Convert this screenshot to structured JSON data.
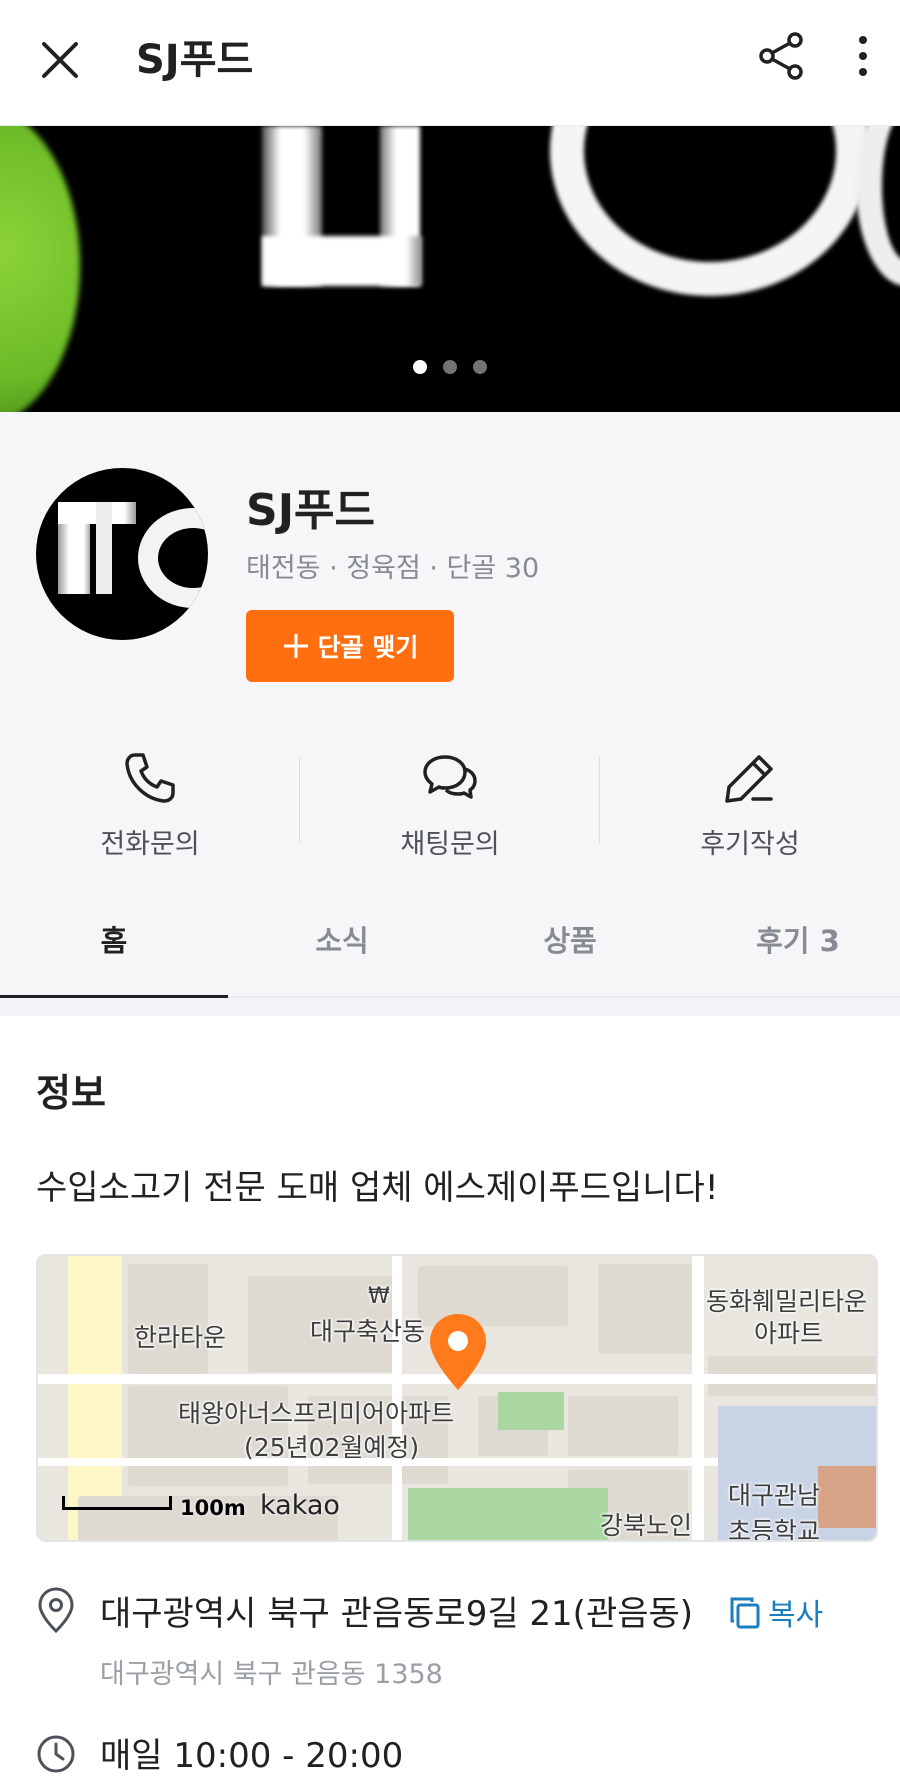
{
  "header": {
    "title": "SJ푸드",
    "icons": [
      "close-icon",
      "share-icon",
      "more-vertical-icon"
    ]
  },
  "banner": {
    "page_count": 3,
    "active_index": 0
  },
  "profile": {
    "name": "SJ푸드",
    "meta": "태전동 · 정육점 · 단골 30",
    "follow_label": "단골 맺기"
  },
  "actions": [
    {
      "label": "전화문의",
      "icon": "phone-icon"
    },
    {
      "label": "채팅문의",
      "icon": "chat-icon"
    },
    {
      "label": "후기작성",
      "icon": "pencil-icon"
    }
  ],
  "tabs": [
    {
      "label": "홈",
      "active": true
    },
    {
      "label": "소식",
      "active": false
    },
    {
      "label": "상품",
      "active": false
    },
    {
      "label": "후기 3",
      "active": false
    }
  ],
  "info": {
    "title": "정보",
    "description": "수입소고기 전문 도매 업체 에스제이푸드입니다!",
    "map": {
      "labels": {
        "place1": "한라타운",
        "place2": "대구축산동",
        "place3": "동화훼밀리타운",
        "place3b": "아파트",
        "place4": "태왕아너스프리미어아파트",
        "place4b": "(25년02월예정)",
        "place5": "강북노인",
        "place6": "대구관남",
        "place6b": "초등학교",
        "won": "₩"
      },
      "scale_label": "100m",
      "provider": "kakao"
    },
    "address": "대구광역시 북구 관음동로9길 21(관음동)",
    "copy_label": "복사",
    "lot_address": "대구광역시 북구 관음동 1358",
    "hours": "매일 10:00 - 20:00"
  },
  "colors": {
    "accent": "#ff6f0f",
    "link": "#1a7ec0",
    "text": "#212124",
    "muted": "#868b94"
  }
}
